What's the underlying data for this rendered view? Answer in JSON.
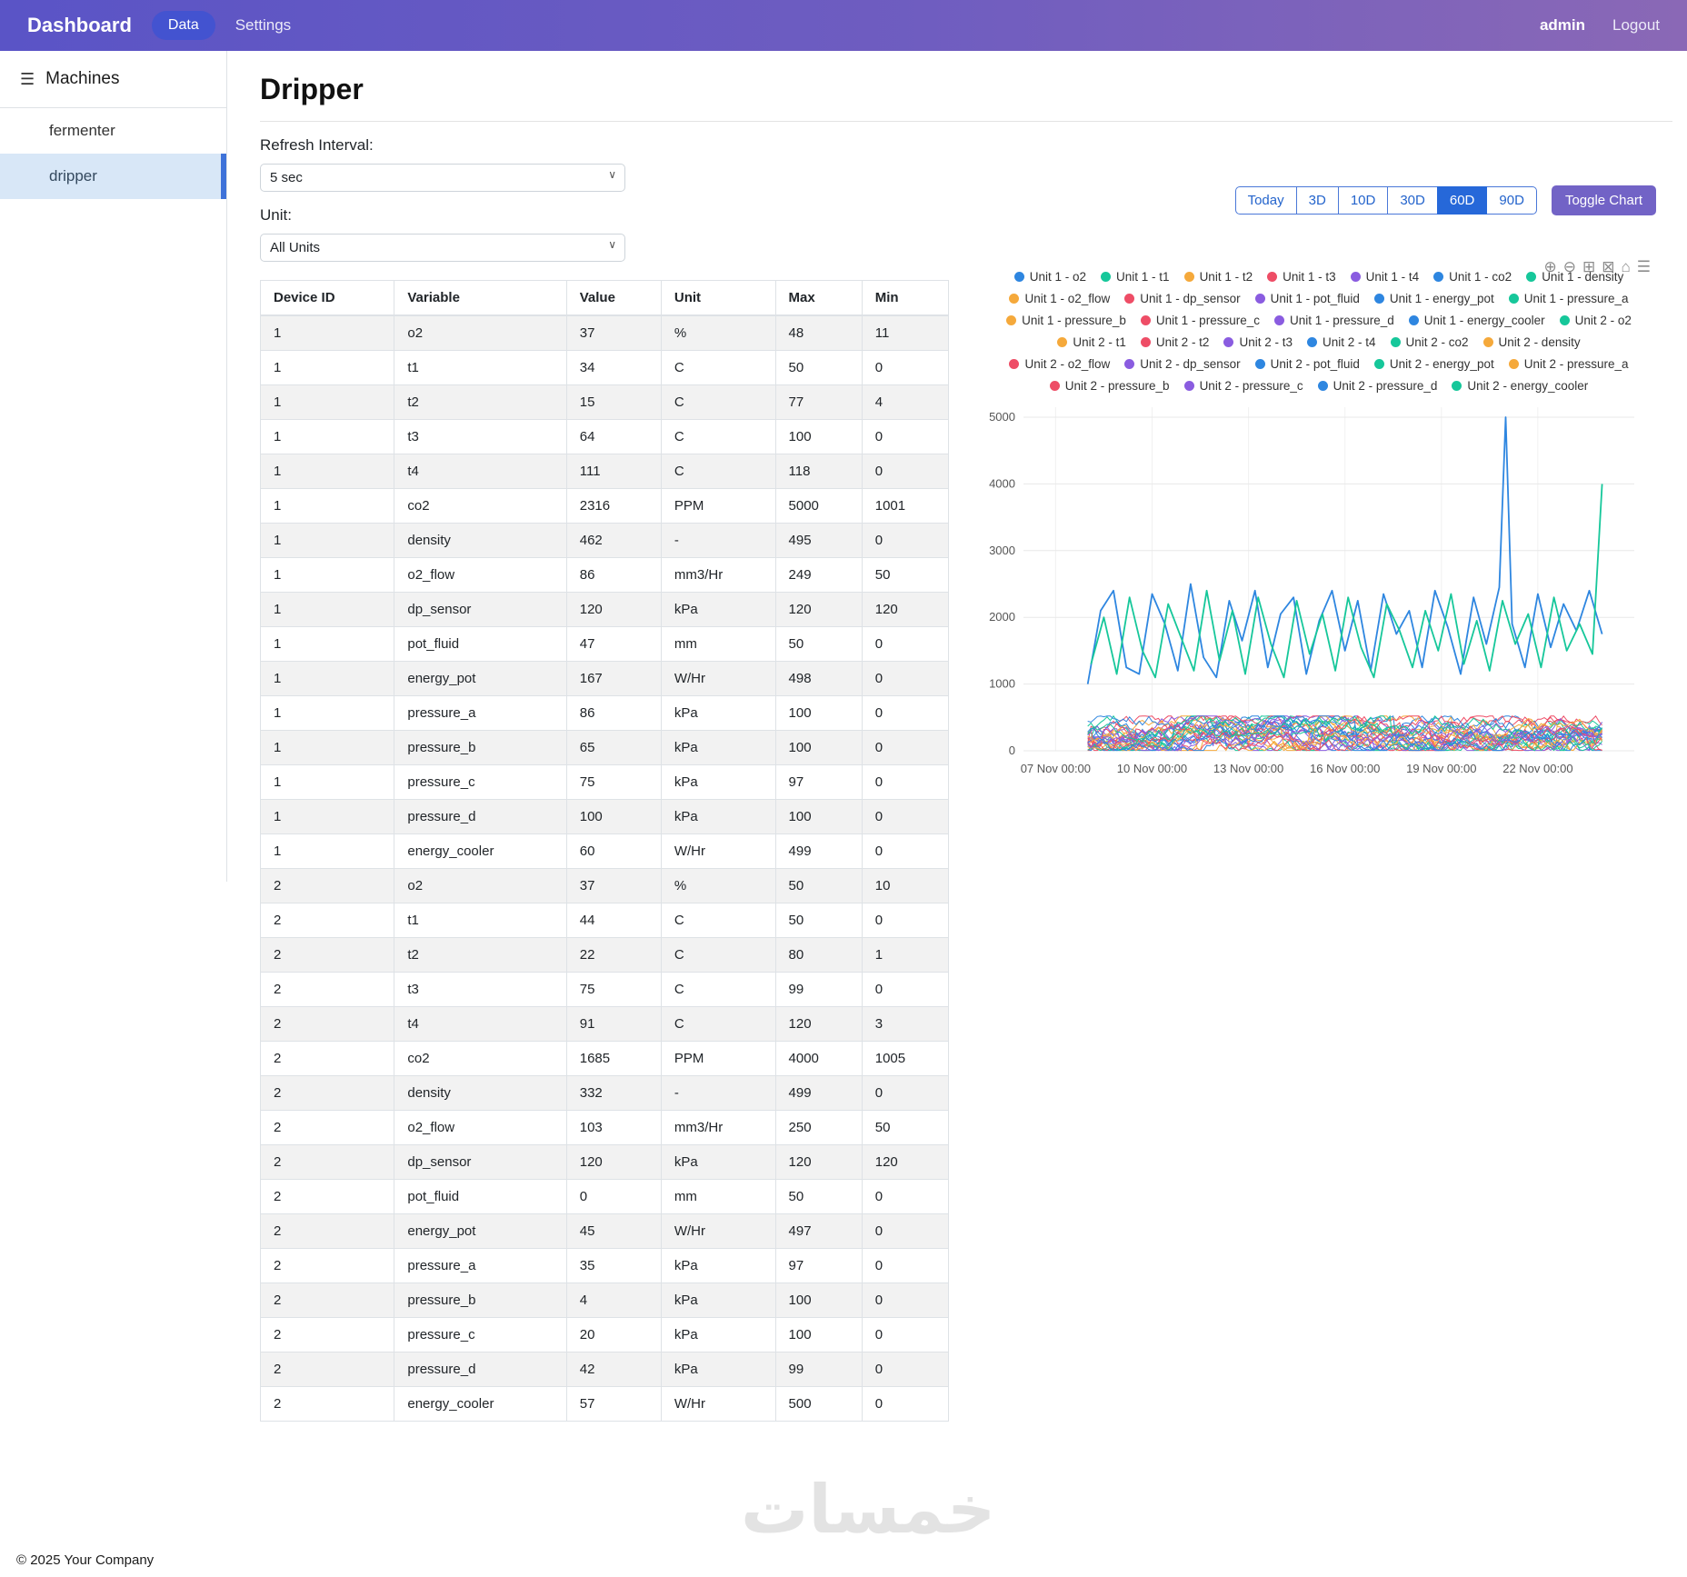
{
  "navbar": {
    "brand": "Dashboard",
    "data_label": "Data",
    "settings_label": "Settings",
    "user": "admin",
    "logout_label": "Logout"
  },
  "icons": {
    "menu": "☰",
    "chevron": "∨"
  },
  "sidebar": {
    "title": "Machines",
    "items": [
      {
        "label": "fermenter",
        "active": false
      },
      {
        "label": "dripper",
        "active": true
      }
    ]
  },
  "page": {
    "title": "Dripper",
    "footer": "© 2025 Your Company",
    "watermark": "خمسات"
  },
  "controls": {
    "refresh_label": "Refresh Interval:",
    "refresh_value": "5 sec",
    "unit_label": "Unit:",
    "unit_value": "All Units"
  },
  "timerange": {
    "options": [
      "Today",
      "3D",
      "10D",
      "30D",
      "60D",
      "90D"
    ],
    "active": "60D",
    "toggle_label": "Toggle Chart"
  },
  "chart_toolbar": [
    {
      "name": "zoom-in-icon",
      "glyph": "⊕"
    },
    {
      "name": "zoom-out-icon",
      "glyph": "⊖"
    },
    {
      "name": "autoscale-icon",
      "glyph": "⊞"
    },
    {
      "name": "pan-icon",
      "glyph": "⊠"
    },
    {
      "name": "home-icon",
      "glyph": "⌂"
    },
    {
      "name": "modebar-menu-icon",
      "glyph": "☰"
    }
  ],
  "table": {
    "headers": [
      "Device ID",
      "Variable",
      "Value",
      "Unit",
      "Max",
      "Min"
    ],
    "rows": [
      [
        "1",
        "o2",
        "37",
        "%",
        "48",
        "11"
      ],
      [
        "1",
        "t1",
        "34",
        "C",
        "50",
        "0"
      ],
      [
        "1",
        "t2",
        "15",
        "C",
        "77",
        "4"
      ],
      [
        "1",
        "t3",
        "64",
        "C",
        "100",
        "0"
      ],
      [
        "1",
        "t4",
        "111",
        "C",
        "118",
        "0"
      ],
      [
        "1",
        "co2",
        "2316",
        "PPM",
        "5000",
        "1001"
      ],
      [
        "1",
        "density",
        "462",
        "-",
        "495",
        "0"
      ],
      [
        "1",
        "o2_flow",
        "86",
        "mm3/Hr",
        "249",
        "50"
      ],
      [
        "1",
        "dp_sensor",
        "120",
        "kPa",
        "120",
        "120"
      ],
      [
        "1",
        "pot_fluid",
        "47",
        "mm",
        "50",
        "0"
      ],
      [
        "1",
        "energy_pot",
        "167",
        "W/Hr",
        "498",
        "0"
      ],
      [
        "1",
        "pressure_a",
        "86",
        "kPa",
        "100",
        "0"
      ],
      [
        "1",
        "pressure_b",
        "65",
        "kPa",
        "100",
        "0"
      ],
      [
        "1",
        "pressure_c",
        "75",
        "kPa",
        "97",
        "0"
      ],
      [
        "1",
        "pressure_d",
        "100",
        "kPa",
        "100",
        "0"
      ],
      [
        "1",
        "energy_cooler",
        "60",
        "W/Hr",
        "499",
        "0"
      ],
      [
        "2",
        "o2",
        "37",
        "%",
        "50",
        "10"
      ],
      [
        "2",
        "t1",
        "44",
        "C",
        "50",
        "0"
      ],
      [
        "2",
        "t2",
        "22",
        "C",
        "80",
        "1"
      ],
      [
        "2",
        "t3",
        "75",
        "C",
        "99",
        "0"
      ],
      [
        "2",
        "t4",
        "91",
        "C",
        "120",
        "3"
      ],
      [
        "2",
        "co2",
        "1685",
        "PPM",
        "4000",
        "1005"
      ],
      [
        "2",
        "density",
        "332",
        "-",
        "499",
        "0"
      ],
      [
        "2",
        "o2_flow",
        "103",
        "mm3/Hr",
        "250",
        "50"
      ],
      [
        "2",
        "dp_sensor",
        "120",
        "kPa",
        "120",
        "120"
      ],
      [
        "2",
        "pot_fluid",
        "0",
        "mm",
        "50",
        "0"
      ],
      [
        "2",
        "energy_pot",
        "45",
        "W/Hr",
        "497",
        "0"
      ],
      [
        "2",
        "pressure_a",
        "35",
        "kPa",
        "97",
        "0"
      ],
      [
        "2",
        "pressure_b",
        "4",
        "kPa",
        "100",
        "0"
      ],
      [
        "2",
        "pressure_c",
        "20",
        "kPa",
        "100",
        "0"
      ],
      [
        "2",
        "pressure_d",
        "42",
        "kPa",
        "99",
        "0"
      ],
      [
        "2",
        "energy_cooler",
        "57",
        "W/Hr",
        "500",
        "0"
      ]
    ]
  },
  "chart_data": {
    "type": "line",
    "x_ticks": [
      "07 Nov 00:00",
      "10 Nov 00:00",
      "13 Nov 00:00",
      "16 Nov 00:00",
      "19 Nov 00:00",
      "22 Nov 00:00"
    ],
    "x_tick_days": [
      0,
      3,
      6,
      9,
      12,
      15
    ],
    "x_range": [
      -1,
      18
    ],
    "y_ticks": [
      0,
      1000,
      2000,
      3000,
      4000,
      5000
    ],
    "y_range": [
      0,
      5150
    ],
    "grid": true,
    "legend_position": "top",
    "legend": [
      {
        "label": "Unit 1 - o2",
        "color": "#2E86E0"
      },
      {
        "label": "Unit 1 - t1",
        "color": "#16C79A"
      },
      {
        "label": "Unit 1 - t2",
        "color": "#F5A93B"
      },
      {
        "label": "Unit 1 - t3",
        "color": "#EE4D66"
      },
      {
        "label": "Unit 1 - t4",
        "color": "#8A5CE0"
      },
      {
        "label": "Unit 1 - co2",
        "color": "#2E86E0"
      },
      {
        "label": "Unit 1 - density",
        "color": "#16C79A"
      },
      {
        "label": "Unit 1 - o2_flow",
        "color": "#F5A93B"
      },
      {
        "label": "Unit 1 - dp_sensor",
        "color": "#EE4D66"
      },
      {
        "label": "Unit 1 - pot_fluid",
        "color": "#8A5CE0"
      },
      {
        "label": "Unit 1 - energy_pot",
        "color": "#2E86E0"
      },
      {
        "label": "Unit 1 - pressure_a",
        "color": "#16C79A"
      },
      {
        "label": "Unit 1 - pressure_b",
        "color": "#F5A93B"
      },
      {
        "label": "Unit 1 - pressure_c",
        "color": "#EE4D66"
      },
      {
        "label": "Unit 1 - pressure_d",
        "color": "#8A5CE0"
      },
      {
        "label": "Unit 1 - energy_cooler",
        "color": "#2E86E0"
      },
      {
        "label": "Unit 2 - o2",
        "color": "#16C79A"
      },
      {
        "label": "Unit 2 - t1",
        "color": "#F5A93B"
      },
      {
        "label": "Unit 2 - t2",
        "color": "#EE4D66"
      },
      {
        "label": "Unit 2 - t3",
        "color": "#8A5CE0"
      },
      {
        "label": "Unit 2 - t4",
        "color": "#2E86E0"
      },
      {
        "label": "Unit 2 - co2",
        "color": "#16C79A"
      },
      {
        "label": "Unit 2 - density",
        "color": "#F5A93B"
      },
      {
        "label": "Unit 2 - o2_flow",
        "color": "#EE4D66"
      },
      {
        "label": "Unit 2 - dp_sensor",
        "color": "#8A5CE0"
      },
      {
        "label": "Unit 2 - pot_fluid",
        "color": "#2E86E0"
      },
      {
        "label": "Unit 2 - energy_pot",
        "color": "#16C79A"
      },
      {
        "label": "Unit 2 - pressure_a",
        "color": "#F5A93B"
      },
      {
        "label": "Unit 2 - pressure_b",
        "color": "#EE4D66"
      },
      {
        "label": "Unit 2 - pressure_c",
        "color": "#8A5CE0"
      },
      {
        "label": "Unit 2 - pressure_d",
        "color": "#2E86E0"
      },
      {
        "label": "Unit 2 - energy_cooler",
        "color": "#16C79A"
      }
    ],
    "series": [
      {
        "name": "Unit 1 - co2",
        "color": "#2E86E0",
        "points": [
          [
            1,
            1000
          ],
          [
            1.4,
            2100
          ],
          [
            1.8,
            2400
          ],
          [
            2.2,
            1250
          ],
          [
            2.6,
            1150
          ],
          [
            3,
            2350
          ],
          [
            3.4,
            1900
          ],
          [
            3.8,
            1200
          ],
          [
            4.2,
            2500
          ],
          [
            4.6,
            1400
          ],
          [
            5,
            1100
          ],
          [
            5.4,
            2250
          ],
          [
            5.8,
            1650
          ],
          [
            6.2,
            2400
          ],
          [
            6.6,
            1250
          ],
          [
            7,
            2050
          ],
          [
            7.4,
            2300
          ],
          [
            7.8,
            1150
          ],
          [
            8.2,
            1950
          ],
          [
            8.6,
            2400
          ],
          [
            9,
            1500
          ],
          [
            9.4,
            2250
          ],
          [
            9.8,
            1200
          ],
          [
            10.2,
            2350
          ],
          [
            10.6,
            1750
          ],
          [
            11,
            2100
          ],
          [
            11.4,
            1250
          ],
          [
            11.8,
            2400
          ],
          [
            12.2,
            1850
          ],
          [
            12.6,
            1150
          ],
          [
            13,
            2300
          ],
          [
            13.4,
            1600
          ],
          [
            13.8,
            2450
          ],
          [
            14,
            5000
          ],
          [
            14.2,
            1900
          ],
          [
            14.6,
            1250
          ],
          [
            15,
            2350
          ],
          [
            15.4,
            1550
          ],
          [
            15.8,
            2200
          ],
          [
            16.2,
            1800
          ],
          [
            16.6,
            2400
          ],
          [
            17,
            1750
          ]
        ]
      },
      {
        "name": "Unit 2 - co2",
        "color": "#16C79A",
        "points": [
          [
            1.1,
            1300
          ],
          [
            1.5,
            2000
          ],
          [
            1.9,
            1150
          ],
          [
            2.3,
            2300
          ],
          [
            2.7,
            1500
          ],
          [
            3.1,
            1100
          ],
          [
            3.5,
            2200
          ],
          [
            3.9,
            1700
          ],
          [
            4.3,
            1200
          ],
          [
            4.7,
            2400
          ],
          [
            5.1,
            1350
          ],
          [
            5.5,
            2100
          ],
          [
            5.9,
            1150
          ],
          [
            6.3,
            2300
          ],
          [
            6.7,
            1600
          ],
          [
            7.1,
            1100
          ],
          [
            7.5,
            2250
          ],
          [
            7.9,
            1450
          ],
          [
            8.3,
            2050
          ],
          [
            8.7,
            1200
          ],
          [
            9.1,
            2300
          ],
          [
            9.5,
            1550
          ],
          [
            9.9,
            1100
          ],
          [
            10.3,
            2200
          ],
          [
            10.7,
            1800
          ],
          [
            11.1,
            1250
          ],
          [
            11.5,
            2100
          ],
          [
            11.9,
            1500
          ],
          [
            12.3,
            2350
          ],
          [
            12.7,
            1300
          ],
          [
            13.1,
            1950
          ],
          [
            13.5,
            1200
          ],
          [
            13.9,
            2250
          ],
          [
            14.3,
            1600
          ],
          [
            14.7,
            2050
          ],
          [
            15.1,
            1250
          ],
          [
            15.5,
            2300
          ],
          [
            15.9,
            1500
          ],
          [
            16.3,
            1900
          ],
          [
            16.7,
            1450
          ],
          [
            17,
            4000
          ]
        ]
      }
    ],
    "background_band": {
      "y_min": 5,
      "y_max": 520,
      "x_start": 1,
      "x_end": 17,
      "step": 0.1
    }
  }
}
